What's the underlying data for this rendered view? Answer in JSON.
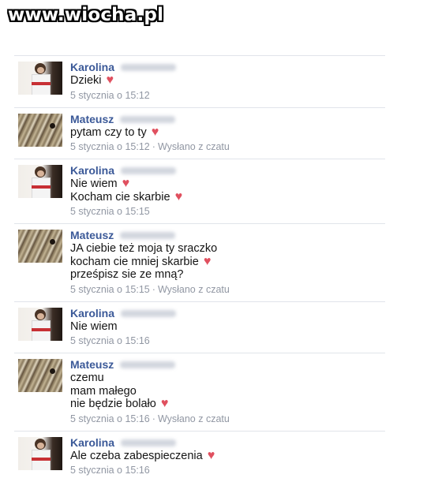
{
  "watermark": "www.wiocha.pl",
  "messages": [
    {
      "sender": "Karolina",
      "avatar": "girl-photo",
      "lines": [
        {
          "text": "Dzieki",
          "heart": true
        }
      ],
      "time": "5 stycznia o 15:12",
      "source": ""
    },
    {
      "sender": "Mateusz",
      "avatar": "snake-photo",
      "lines": [
        {
          "text": "pytam czy to ty",
          "heart": true
        }
      ],
      "time": "5 stycznia o 15:12",
      "source": "Wysłano z czatu"
    },
    {
      "sender": "Karolina",
      "avatar": "girl-photo",
      "lines": [
        {
          "text": "Nie wiem",
          "heart": true
        },
        {
          "text": "Kocham cie skarbie",
          "heart": true
        }
      ],
      "time": "5 stycznia o 15:15",
      "source": ""
    },
    {
      "sender": "Mateusz",
      "avatar": "snake-photo",
      "lines": [
        {
          "text": "JA ciebie też moja ty sraczko",
          "heart": false
        },
        {
          "text": "kocham cie mniej skarbie",
          "heart": true
        },
        {
          "text": "prześpisz sie ze mną?",
          "heart": false
        }
      ],
      "time": "5 stycznia o 15:15",
      "source": "Wysłano z czatu"
    },
    {
      "sender": "Karolina",
      "avatar": "girl-photo",
      "lines": [
        {
          "text": "Nie wiem",
          "heart": false
        }
      ],
      "time": "5 stycznia o 15:16",
      "source": ""
    },
    {
      "sender": "Mateusz",
      "avatar": "snake-photo",
      "lines": [
        {
          "text": "czemu",
          "heart": false
        },
        {
          "text": "mam małego",
          "heart": false
        },
        {
          "text": "nie będzie bolało",
          "heart": true
        }
      ],
      "time": "5 stycznia o 15:16",
      "source": "Wysłano z czatu"
    },
    {
      "sender": "Karolina",
      "avatar": "girl-photo",
      "lines": [
        {
          "text": "Ale czeba zabespieczenia",
          "heart": true
        }
      ],
      "time": "5 stycznia o 15:16",
      "source": ""
    }
  ],
  "colors": {
    "name": "#3b5998",
    "meta": "#9197a3",
    "heart": "#e0505f"
  },
  "icons": {
    "heart": "heart-icon"
  }
}
